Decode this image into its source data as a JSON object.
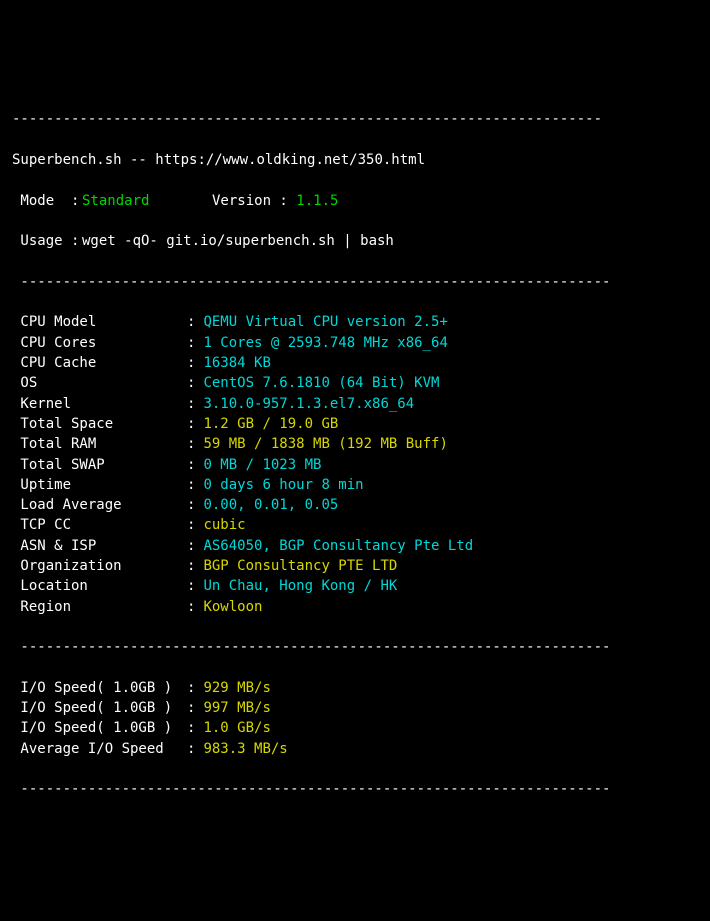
{
  "hr": "----------------------------------------------------------------------",
  "hr2": " ----------------------------------------------------------------------",
  "header": {
    "title": "Superbench.sh",
    "sep": " -- ",
    "url": "https://www.oldking.net/350.html",
    "mode_label": " Mode  : ",
    "mode_value": "Standard",
    "version_label": "Version : ",
    "version_value": "1.1.5",
    "usage_label": " Usage : ",
    "usage_value": "wget -qO- git.io/superbench.sh | bash"
  },
  "sys": [
    {
      "label": " CPU Model",
      "value": "QEMU Virtual CPU version 2.5+",
      "cls": "cyan"
    },
    {
      "label": " CPU Cores",
      "value": "1 Cores @ 2593.748 MHz x86_64",
      "cls": "cyan"
    },
    {
      "label": " CPU Cache",
      "value": "16384 KB",
      "cls": "cyan"
    },
    {
      "label": " OS",
      "value": "CentOS 7.6.1810 (64 Bit) KVM",
      "cls": "cyan"
    },
    {
      "label": " Kernel",
      "value": "3.10.0-957.1.3.el7.x86_64",
      "cls": "cyan"
    },
    {
      "label": " Total Space",
      "value": "1.2 GB / 19.0 GB",
      "cls": "yellow"
    },
    {
      "label": " Total RAM",
      "value": "59 MB / 1838 MB (192 MB Buff)",
      "cls": "yellow"
    },
    {
      "label": " Total SWAP",
      "value": "0 MB / 1023 MB",
      "cls": "cyan"
    },
    {
      "label": " Uptime",
      "value": "0 days 6 hour 8 min",
      "cls": "cyan"
    },
    {
      "label": " Load Average",
      "value": "0.00, 0.01, 0.05",
      "cls": "cyan"
    },
    {
      "label": " TCP CC",
      "value": "cubic",
      "cls": "yellow"
    },
    {
      "label": " ASN & ISP",
      "value": "AS64050, BGP Consultancy Pte Ltd",
      "cls": "cyan"
    },
    {
      "label": " Organization",
      "value": "BGP Consultancy PTE LTD",
      "cls": "yellow"
    },
    {
      "label": " Location",
      "value": "Un Chau, Hong Kong / HK",
      "cls": "cyan"
    },
    {
      "label": " Region",
      "value": "Kowloon",
      "cls": "yellow"
    }
  ],
  "io": [
    {
      "label": " I/O Speed( 1.0GB )",
      "value": "929 MB/s",
      "cls": "yellow"
    },
    {
      "label": " I/O Speed( 1.0GB )",
      "value": "997 MB/s",
      "cls": "yellow"
    },
    {
      "label": " I/O Speed( 1.0GB )",
      "value": "1.0 GB/s",
      "cls": "yellow"
    },
    {
      "label": " Average I/O Speed",
      "value": "983.3 MB/s",
      "cls": "yellow"
    }
  ]
}
